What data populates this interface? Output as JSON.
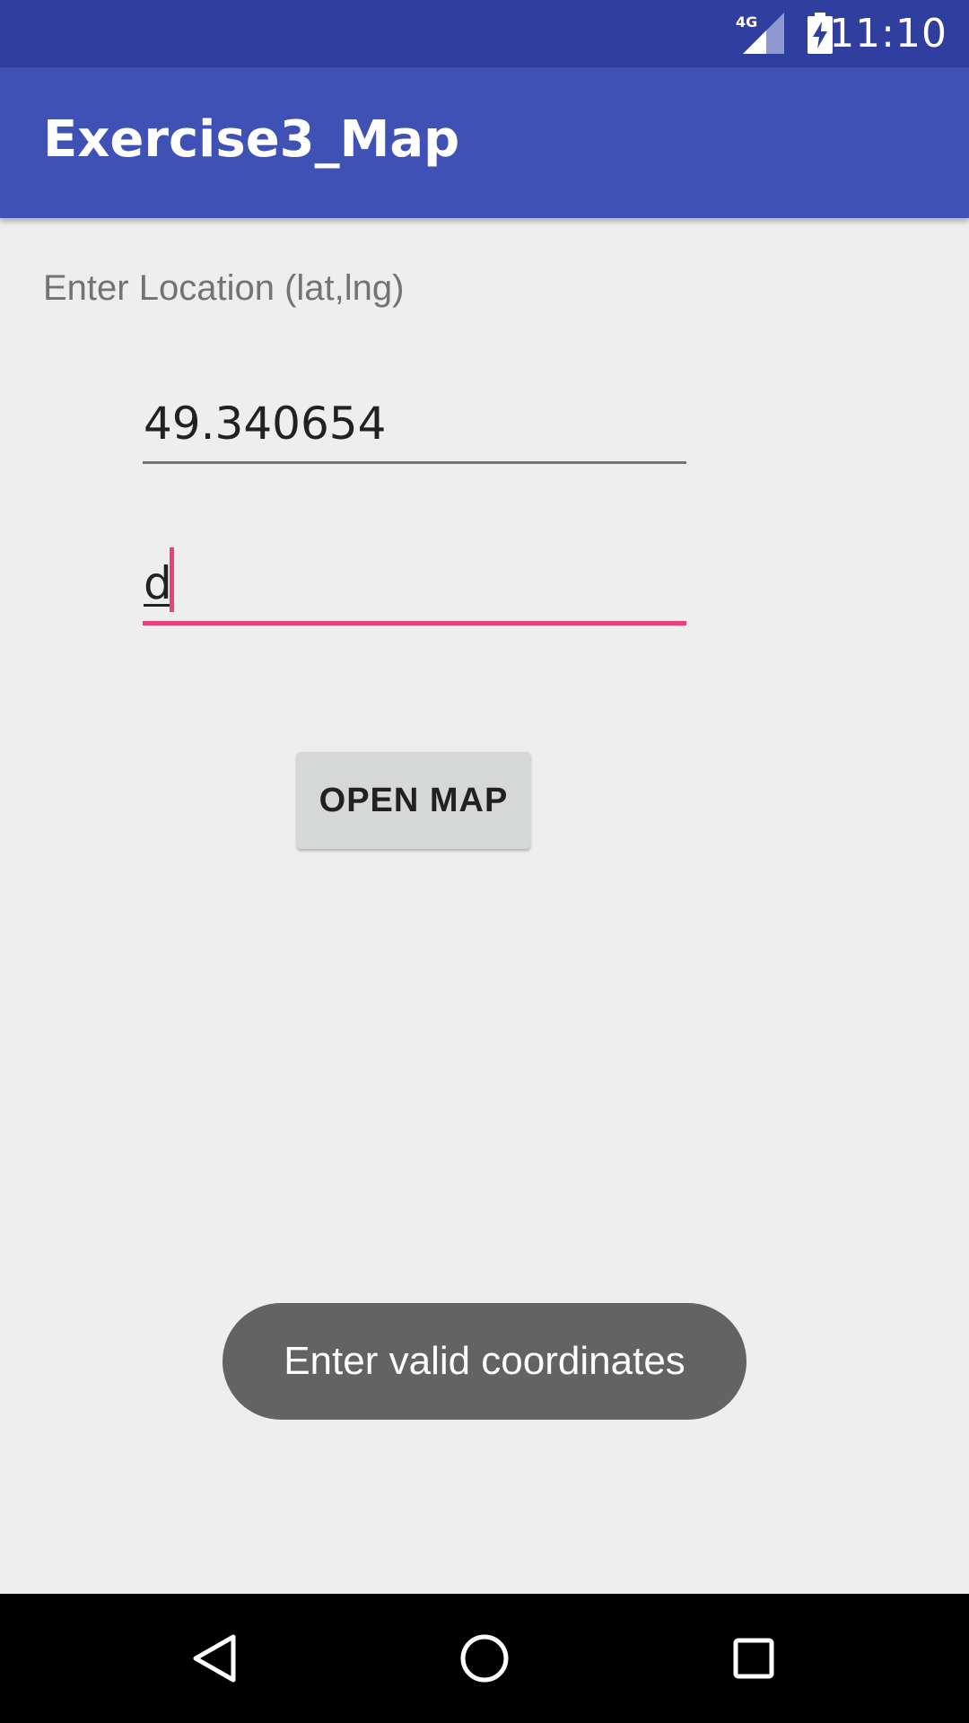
{
  "status_bar": {
    "network_label": "4G",
    "time": "11:10"
  },
  "app_bar": {
    "title": "Exercise3_Map"
  },
  "form": {
    "location_label": "Enter Location (lat,lng)",
    "latitude_value": "49.340654",
    "longitude_value": "d",
    "open_map_label": "OPEN MAP"
  },
  "toast": {
    "message": "Enter valid coordinates"
  },
  "colors": {
    "status_bar": "#303f9f",
    "app_bar": "#3f51b5",
    "accent": "#ec407a",
    "background": "#eeeeee"
  },
  "icons": {
    "network": "signal-4g-icon",
    "battery": "battery-charging-icon",
    "back": "back-triangle-icon",
    "home": "home-circle-icon",
    "recents": "recents-square-icon"
  }
}
